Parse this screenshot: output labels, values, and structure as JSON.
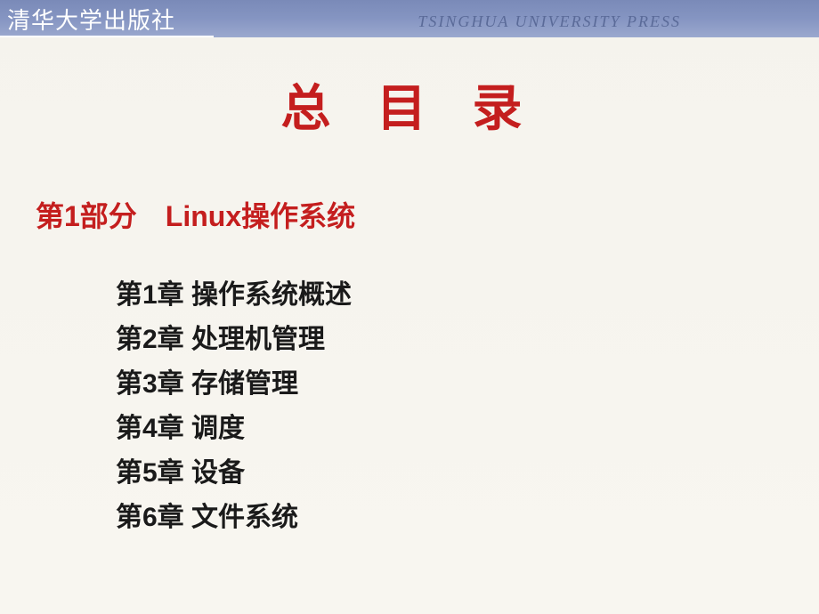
{
  "header": {
    "publisher_cn": "清华大学出版社",
    "publisher_en": "TSINGHUA UNIVERSITY PRESS"
  },
  "title": "总  目  录",
  "part": {
    "label": "第1部分　Linux操作系统"
  },
  "chapters": [
    "第1章  操作系统概述",
    "第2章  处理机管理",
    "第3章  存储管理",
    "第4章  调度",
    "第5章  设备",
    "第6章  文件系统"
  ]
}
